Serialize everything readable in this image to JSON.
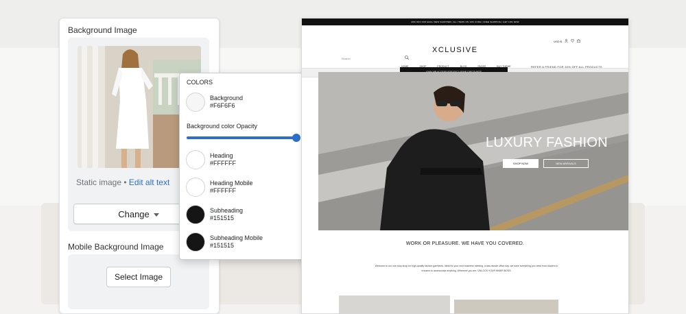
{
  "settings": {
    "background_image_title": "Background Image",
    "image_static_label": "Static image",
    "image_separator": "•",
    "edit_alt_text": "Edit alt text",
    "change_button": "Change",
    "mobile_background_title": "Mobile Background Image",
    "select_image_button": "Select Image"
  },
  "colors_popover": {
    "heading": "COLORS",
    "opacity_label": "Background color Opacity",
    "opacity_value": "1",
    "opacity_fraction": 1,
    "swatches": [
      {
        "name": "Background",
        "hex": "#F6F6F6"
      },
      {
        "name": "Heading",
        "hex": "#FFFFFF"
      },
      {
        "name": "Heading Mobile",
        "hex": "#FFFFFF"
      },
      {
        "name": "Subheading",
        "hex": "#151515"
      },
      {
        "name": "Subheading Mobile",
        "hex": "#151515"
      }
    ]
  },
  "store": {
    "announcement": "20% OFF FOR EACH NEW SHOPPER | ALL ITEMS ON 10% CODE | FREE SHIPPING | GET 10% NOW",
    "logo": "XCLUSIVE",
    "search_placeholder": "Search",
    "currency": "USD $",
    "nav": [
      "HOME",
      "SHOP",
      "PRODUCT",
      "BLOG",
      "PAGES",
      "BUY THEME"
    ],
    "strip_left": "FREE SHIPPING WHEN YOU SPEND US$ 150",
    "strip_center": "GAIN VIP ACCESS FOR EXCLUSIVE DISCOUNTS",
    "strip_right": "REFER A FRIEND FOR 30% OFF ALL PRODUCTS",
    "hero_title": "LUXURY FASHION",
    "hero_primary_button": "SHOP NOW",
    "hero_secondary_button": "NEW ARRIVALS",
    "tagline": "WORK OR PLEASURE. WE HAVE YOU COVERED.",
    "paragraph": "Welcome to our one-stop shop for high-quality fashion garments. Ideal for your next business meeting, a last-minute office day, we have everything you need from blazers to trousers to accessorise anything. Wherever you are. UNLOCK YOUR INNER BOSS."
  }
}
